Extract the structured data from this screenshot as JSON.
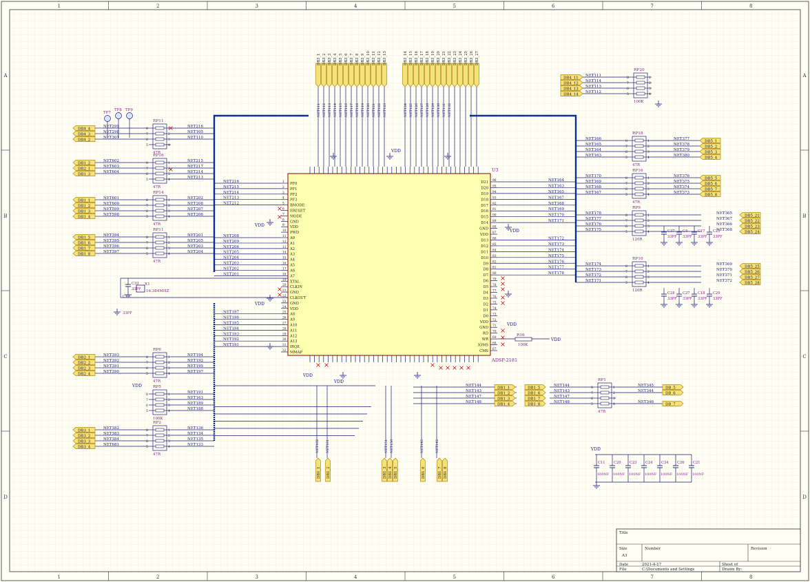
{
  "theme": {
    "paper": "#fffff5",
    "grid": "#e6e6d6",
    "wire": "#1a1a7a",
    "bus": "#0c2f8c",
    "designator": "#8a1a8a",
    "net_label": "#1a1a7a",
    "port_fill": "#f4e27a",
    "port_stroke": "#b8860b",
    "power": "#1a1a8a",
    "no_connect": "#d01010",
    "chip_fill": "#ffffb0",
    "chip_stroke": "#8a0000"
  },
  "sheet": {
    "zones_top": [
      "1",
      "2",
      "3",
      "4",
      "5",
      "6",
      "7",
      "8"
    ],
    "zones_side": [
      "A",
      "B",
      "C",
      "D"
    ]
  },
  "chip": {
    "designator": "U3",
    "part": "ADSP-2181",
    "left_pins": [
      "PF0",
      "PF1",
      "PF2",
      "PF3",
      "BMODE",
      "ERESET",
      "MODE",
      "GND",
      "VDD",
      "PWD",
      "A0",
      "A1",
      "A2",
      "A3",
      "A4",
      "A5",
      "A6",
      "A7",
      "XTAL",
      "CLKIN",
      "GND",
      "CLKOUT",
      "GND",
      "VDD",
      "A8",
      "A9",
      "A10",
      "A11",
      "A12",
      "A13",
      "IRQE",
      "MMAP"
    ],
    "right_pins": [
      "D21",
      "D20",
      "D19",
      "D18",
      "D17",
      "D16",
      "D15",
      "D14",
      "GND",
      "VDD",
      "D13",
      "D12",
      "D11",
      "D10",
      "D9",
      "D8",
      "D7",
      "D6",
      "D5",
      "D4",
      "D3",
      "D2",
      "D1",
      "D0",
      "VDD",
      "GND",
      "RD",
      "WR",
      "IOMS",
      "CMS"
    ],
    "right_nums": [
      "96",
      "95",
      "94",
      "93",
      "92",
      "91",
      "90",
      "89",
      "88",
      "87",
      "86",
      "85",
      "84",
      "83",
      "82",
      "81",
      "80",
      "79",
      "78",
      "77",
      "76",
      "75",
      "74",
      "73",
      "72",
      "71",
      "70",
      "69",
      "68",
      "67"
    ]
  },
  "resistor_packs": [
    {
      "ref": "RP11",
      "value": "47R",
      "left_nets": [
        "NET299",
        "NET298",
        "NET301"
      ],
      "right_nets": [
        "NET216",
        "NET105",
        "NET110"
      ],
      "ports": [
        "DB4_4",
        "DB4_3",
        "DB4_2"
      ]
    },
    {
      "ref": "RP16",
      "value": "47R",
      "left_nets": [
        "NET602",
        "NET603",
        "NET604"
      ],
      "right_nets": [
        "NET215",
        "NET217",
        "NET214",
        "NET213"
      ],
      "ports": [
        "DB1_2",
        "DB2_1",
        "DB1_3"
      ]
    },
    {
      "ref": "RP14",
      "value": "47R",
      "left_nets": [
        "NET601",
        "NET600",
        "NET599",
        "NET598"
      ],
      "right_nets": [
        "NET202",
        "NET208",
        "NET207",
        "NET206"
      ],
      "ports": [
        "DB1_1",
        "DB1_2",
        "DB1_3",
        "DB1_4"
      ]
    },
    {
      "ref": "RP11",
      "value": "47R",
      "left_nets": [
        "NET394",
        "NET395",
        "NET396",
        "NET397"
      ],
      "right_nets": [
        "NET201",
        "NET205",
        "NET203",
        "NET204"
      ],
      "ports": [
        "DB1_5",
        "DB1_6",
        "DB1_7",
        "DB1_8"
      ]
    },
    {
      "ref": "RP6",
      "value": "47R",
      "left_nets": [
        "NET393",
        "NET392",
        "NET391",
        "NET390"
      ],
      "right_nets": [
        "NET194",
        "NET192",
        "NET195",
        "NET197"
      ],
      "ports": [
        "DB2_1",
        "DB2_2",
        "DB2_3",
        "DB2_4"
      ]
    },
    {
      "ref": "RP5",
      "value": "100K",
      "left_nets": [],
      "right_nets": [
        "NET191",
        "NET163",
        "NET189",
        "NET188"
      ],
      "ports": []
    },
    {
      "ref": "RP2",
      "value": "47R",
      "left_nets": [
        "NET382",
        "NET383",
        "NET384",
        "NET681"
      ],
      "right_nets": [
        "NET136",
        "NET134",
        "NET135",
        "NET133"
      ],
      "ports": [
        "DB3_1",
        "DB3_2",
        "DB3_3",
        "DB3_4"
      ]
    }
  ],
  "right_packs": [
    {
      "ref": "RP20",
      "value": "100K",
      "left_nets": [
        "NET111",
        "NET114",
        "NET113",
        "NET112"
      ],
      "ports": [
        "DB4_11",
        "DB4_12",
        "DB4_13",
        "DB4_14"
      ]
    },
    {
      "ref": "RP18",
      "value": "47R",
      "left_nets": [
        "NET166",
        "NET165",
        "NET164",
        "NET163"
      ],
      "right_nets": [
        "NET377",
        "NET378",
        "NET379",
        "NET380"
      ],
      "ports": [
        "DB5_1",
        "DB5_2",
        "DB5_3",
        "DB5_4"
      ]
    },
    {
      "ref": "RP16",
      "value": "47R",
      "left_nets": [
        "NET170",
        "NET169",
        "NET168",
        "NET167"
      ],
      "right_nets": [
        "NET376",
        "NET375",
        "NET374",
        "NET373"
      ],
      "ports": [
        "DB5_5",
        "DB5_6",
        "DB5_7",
        "DB5_8"
      ]
    },
    {
      "ref": "RP9",
      "value": "120R",
      "left_nets": [
        "NET178",
        "NET177",
        "NET176",
        "NET175"
      ],
      "right_nets": [
        "NET365",
        "NET367",
        "NET366",
        "NET368"
      ],
      "ports": [
        "DB5_21",
        "DB5_22",
        "DB5_23",
        "DB5_24"
      ]
    },
    {
      "ref": "RP10",
      "value": "120R",
      "left_nets": [
        "NET174",
        "NET173",
        "NET172",
        "NET171"
      ],
      "right_nets": [
        "NET369",
        "NET370",
        "NET371",
        "NET372"
      ],
      "ports": [
        "DB5_25",
        "DB5_26",
        "DB5_27",
        "DB5_28"
      ]
    }
  ],
  "right_chip_nets": [
    "NET164",
    "NET163",
    "NET165",
    "NET167",
    "NET168",
    "NET169",
    "NET170",
    "NET171",
    "NET172",
    "NET173",
    "NET174",
    "NET175",
    "NET176",
    "NET177",
    "NET178"
  ],
  "left_chip_nets": [
    "NET216",
    "NET215",
    "NET214",
    "NET213",
    "NET212",
    "NET208",
    "NET209",
    "NET206",
    "NET205",
    "NET204",
    "NET203",
    "NET202",
    "NET201",
    "NET197",
    "NET196",
    "NET195",
    "NET194",
    "NET193",
    "NET192",
    "NET191"
  ],
  "top_ports": [
    "DB3_1",
    "DB3_2",
    "DB3_3",
    "DB3_4",
    "DB3_5",
    "DB3_6",
    "DB3_7",
    "DB3_8",
    "DB3_9",
    "DB3_10",
    "DB3_11",
    "DB3_12",
    "DB3_13",
    "DB3_14",
    "DB3_15",
    "DB3_16",
    "DB3_17",
    "DB3_18",
    "DB3_19",
    "DB3_20",
    "DB3_21",
    "DB3_22",
    "DB3_23",
    "DB3_24",
    "DB3_25",
    "DB3_26",
    "DB3_27"
  ],
  "top_nets": [
    "NET111",
    "NET112",
    "NET113",
    "NET114",
    "NET115",
    "NET116",
    "NET117",
    "NET118",
    "NET119",
    "NET120",
    "NET121",
    "NET122",
    "NET123",
    "NET124",
    "NET125",
    "NET126",
    "NET127",
    "NET128",
    "NET129",
    "NET130",
    "NET131",
    "NET132"
  ],
  "bottom_ports": [
    "DB1_1",
    "DB1_2",
    "DB1_3",
    "DB1_4",
    "DB1_5",
    "DB1_6",
    "DB1_7",
    "DB1_8"
  ],
  "bottom_nets": [
    "NET162",
    "NET161",
    "NET151",
    "NET150",
    "NET145",
    "NET142"
  ],
  "rp1": {
    "ref": "RP1",
    "value": "47R",
    "left_nets": [
      "NET144",
      "NET143",
      "NET147",
      "NET148"
    ],
    "right_nets": [
      "NET345",
      "NET344",
      "NET346"
    ],
    "ports_left": [
      "DB1_1",
      "DB1_2",
      "DB1_3",
      "DB1_4"
    ],
    "ports_mid": [
      "DB1_5",
      "DB1_6",
      "DB1_7",
      "DB1_8"
    ],
    "ports_right": [
      "DB_5",
      "DB_6",
      "DB_7"
    ]
  },
  "r16": {
    "ref": "R16",
    "value": "100K",
    "power": "VDD"
  },
  "crystal": {
    "ref": "X1",
    "value": "16.384MHZ",
    "caps": [
      {
        "ref": "C33",
        "value": "33PF"
      },
      {
        "ref": "C12",
        "value": "33PF"
      }
    ]
  },
  "test_points": [
    "TP7",
    "TP8",
    "TP9"
  ],
  "filter_caps_top": [
    {
      "ref": "C37",
      "value": "33PF"
    },
    {
      "ref": "C4",
      "value": "33PF"
    },
    {
      "ref": "C17",
      "value": "33PF"
    },
    {
      "ref": "C25",
      "value": "33PF"
    }
  ],
  "filter_caps_bot": [
    {
      "ref": "C28",
      "value": "33PF"
    },
    {
      "ref": "C27",
      "value": "33PF"
    },
    {
      "ref": "C18",
      "value": "33PF"
    },
    {
      "ref": "C29",
      "value": "33PF"
    }
  ],
  "decoupling": {
    "power": "VDD",
    "caps": [
      {
        "ref": "C11",
        "value": "100NF"
      },
      {
        "ref": "C20",
        "value": "100NF"
      },
      {
        "ref": "C23",
        "value": "100NF"
      },
      {
        "ref": "C24",
        "value": "100NF"
      },
      {
        "ref": "C34",
        "value": "100NF"
      },
      {
        "ref": "C26",
        "value": "100NF"
      },
      {
        "ref": "C21",
        "value": "100NF"
      }
    ]
  },
  "power_labels": {
    "vdd": "VDD",
    "gnd": "GND"
  },
  "title_block": {
    "title_label": "Title",
    "size_label": "Size",
    "size_value": "A3",
    "number_label": "Number",
    "revision_label": "Revision",
    "date_label": "Date",
    "date_value": "2021-4-17",
    "file_label": "File",
    "file_value": "C:\\Documents and Settings",
    "sheet_label": "Sheet   of",
    "drawn_label": "Drawn By:"
  }
}
